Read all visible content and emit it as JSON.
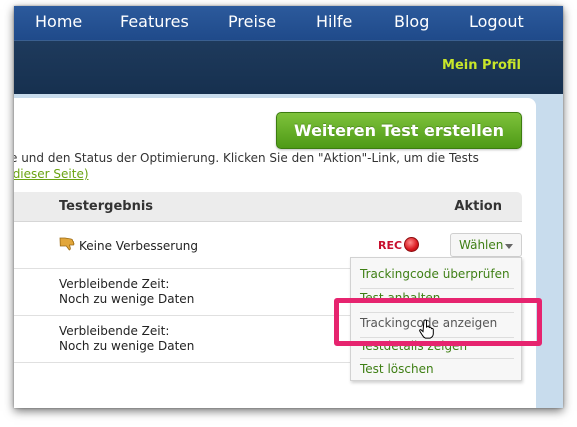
{
  "nav": {
    "items": [
      "Home",
      "Features",
      "Preise",
      "Hilfe",
      "Blog",
      "Logout"
    ],
    "profile": "Mein Profil"
  },
  "toolbar": {
    "new_test_button": "Weiteren Test erstellen"
  },
  "intro": {
    "line1": "e und den Status der Optimierung. Klicken Sie den \"Aktion\"-Link, um die Tests",
    "line2_link": "dieser Seite)"
  },
  "table": {
    "headers": {
      "result": "Testergebnis",
      "action": "Aktion"
    },
    "rows": [
      {
        "result": "Keine Verbesserung",
        "rec_label": "REC",
        "select_label": "Wählen"
      },
      {
        "result_line1": "Verbleibende Zeit:",
        "result_line2": "Noch zu wenige Daten"
      },
      {
        "result_line1": "Verbleibende Zeit:",
        "result_line2": "Noch zu wenige Daten"
      }
    ]
  },
  "menu": {
    "items": [
      "Trackingcode überprüfen",
      "Test anhalten",
      "Trackingcode anzeigen",
      "Testdetails zeigen",
      "Test löschen"
    ]
  },
  "colors": {
    "nav_bg": "#2c5a9c",
    "subnav_bg": "#1e3a5c",
    "profile_link": "#c8e62a",
    "button_green": "#6cb22c",
    "link_green": "#3e7f14",
    "rec_red": "#c8102e",
    "highlight_pink": "#e6246f"
  }
}
